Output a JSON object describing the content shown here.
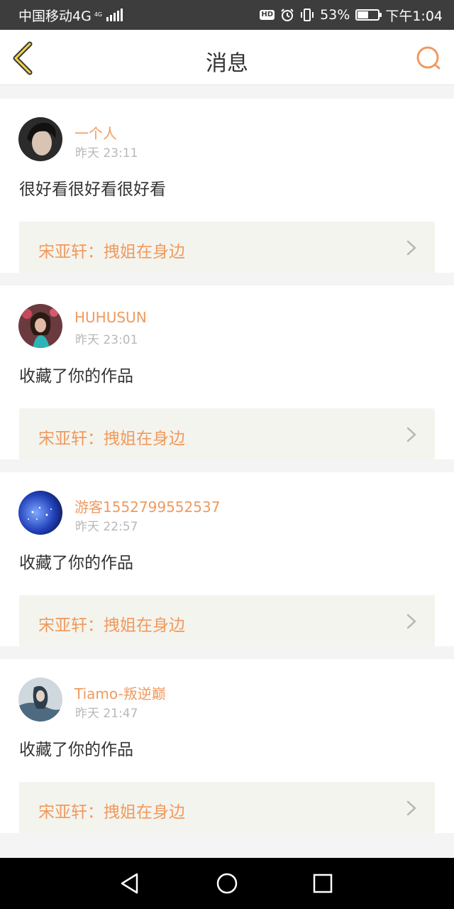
{
  "status_bar": {
    "carrier": "中国移动4G",
    "network_badge_top": "4G",
    "network_badge_bottom": "",
    "hd_label": "HD",
    "battery_percent": "53%",
    "battery_level": 0.53,
    "time": "下午1:04"
  },
  "header": {
    "title": "消息",
    "back_icon": "chevron-left-icon",
    "search_icon": "search-icon"
  },
  "messages": [
    {
      "user": "一个人",
      "time": "昨天 23:11",
      "text": "很好看很好看很好看",
      "work": "宋亚轩：拽姐在身边",
      "avatar_color": "#2b2b2b"
    },
    {
      "user": "HUHUSUN",
      "time": "昨天 23:01",
      "text": "收藏了你的作品",
      "work": "宋亚轩：拽姐在身边",
      "avatar_color": "#6b3a3f"
    },
    {
      "user": "游客1552799552537",
      "time": "昨天 22:57",
      "text": "收藏了你的作品",
      "work": "宋亚轩：拽姐在身边",
      "avatar_color": "#2140b8"
    },
    {
      "user": "Tiamo-叛逆巅",
      "time": "昨天 21:47",
      "text": "收藏了你的作品",
      "work": "宋亚轩：拽姐在身边",
      "avatar_color": "#4d6a80"
    }
  ],
  "colors": {
    "accent": "#f09a5e",
    "status_bar": "#3d3d3d",
    "link_bg": "#f4f4ee"
  },
  "nav": {
    "back_icon": "triangle-back-icon",
    "home_icon": "circle-home-icon",
    "recent_icon": "square-recent-icon"
  }
}
